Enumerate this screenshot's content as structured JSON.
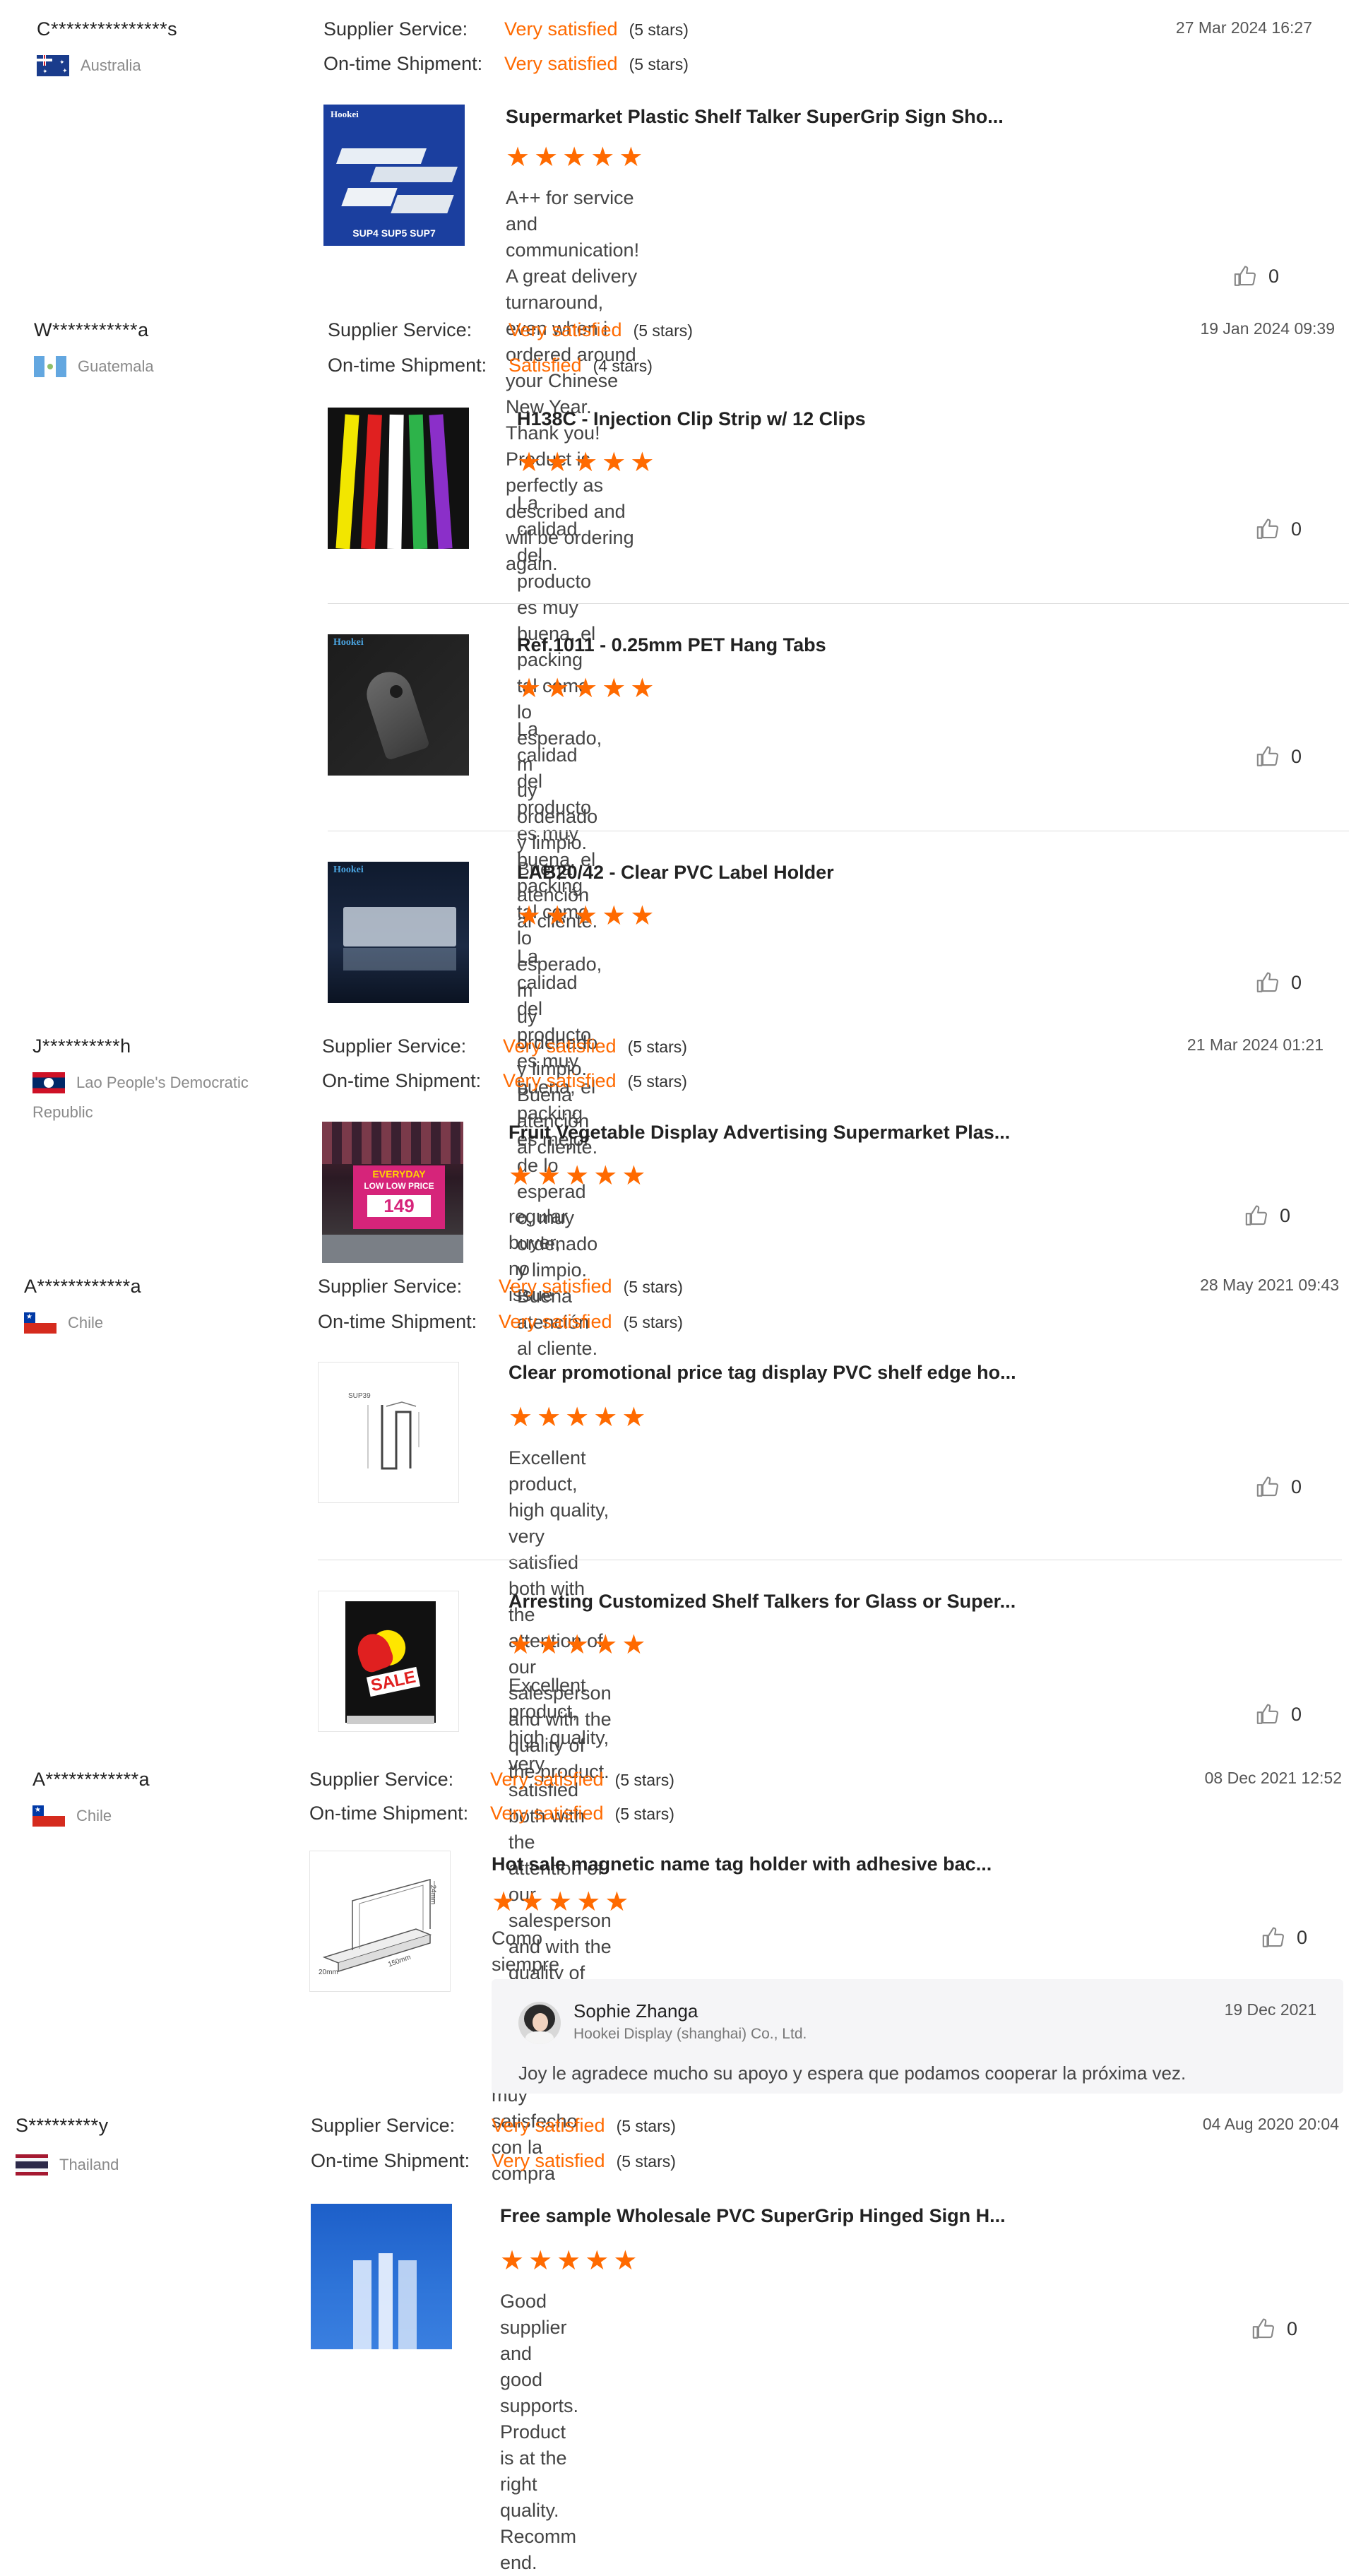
{
  "labels": {
    "supplier_service": "Supplier Service:",
    "ontime_shipment": "On-time Shipment:"
  },
  "colors": {
    "accent": "#ff6a00",
    "divider": "#dddddd",
    "reply_bg": "#f5f5f7"
  },
  "icons": {
    "like": "thumbs-up-icon",
    "star": "star-icon"
  },
  "reviews": [
    {
      "user": "C***************s",
      "country": "Australia",
      "date": "27 Mar 2024 16:27",
      "supplier_value": "Very satisfied",
      "supplier_stars": "(5 stars)",
      "shipment_value": "Very satisfied",
      "shipment_stars": "(5 stars)",
      "products": [
        {
          "title": "Supermarket Plastic Shelf Talker SuperGrip Sign Sho...",
          "rating": 5,
          "comment_lines": [
            "A++ for service and communication!",
            "A great delivery turnaround,",
            "even when i ordered around your Chinese New Year. Thank you!",
            "Product is perfectly as described and will be ordering again."
          ],
          "likes": "0",
          "thumb_text": "SUP4 SUP5 SUP7",
          "thumb_brand": "Hookei"
        }
      ]
    },
    {
      "user": "W***********a",
      "country": "Guatemala",
      "date": "19 Jan 2024 09:39",
      "supplier_value": "Very satisfied",
      "supplier_stars": "(5 stars)",
      "shipment_value": "Satisfied",
      "shipment_stars": "(4 stars)",
      "products": [
        {
          "title": "H138C - Injection Clip Strip w/ 12 Clips",
          "rating": 5,
          "comment_lines": [
            "La calidad del producto es muy buena, el packing tal como lo esperado, m",
            "uy ordenado y limpio. Buena atención al cliente."
          ],
          "likes": "0"
        },
        {
          "title": "Ref.1011 - 0.25mm PET Hang Tabs",
          "rating": 5,
          "comment_lines": [
            "La calidad del producto es muy buena, el packing tal como lo esperado, m",
            "uy ordenado y limpio. Buena atención al cliente."
          ],
          "likes": "0",
          "thumb_brand": "Hookei"
        },
        {
          "title": "LAB20/42 - Clear PVC Label Holder",
          "rating": 5,
          "comment_lines": [
            "La calidad del producto es muy buena, el packing es mejor de lo esperad",
            "o, muy ordenado y limpio. Buena atención al cliente."
          ],
          "likes": "0",
          "thumb_brand": "Hookei"
        }
      ]
    },
    {
      "user": "J**********h",
      "country_lines": [
        "Lao People's Democratic",
        "Republic"
      ],
      "date": "21 Mar 2024 01:21",
      "supplier_value": "Very satisfied",
      "supplier_stars": "(5 stars)",
      "shipment_value": "Very satisfied",
      "shipment_stars": "(5 stars)",
      "products": [
        {
          "title": "Fruit Vegetable Display Advertising Supermarket Plas...",
          "rating": 5,
          "comment_lines": [
            "regular buyer, no issue"
          ],
          "likes": "0",
          "thumb_text_1": "EVERYDAY",
          "thumb_text_2": "LOW LOW PRICE",
          "thumb_text_3": "149"
        }
      ]
    },
    {
      "user": "A************a",
      "country": "Chile",
      "date": "28 May 2021 09:43",
      "supplier_value": "Very satisfied",
      "supplier_stars": "(5 stars)",
      "shipment_value": "Very satisfied",
      "shipment_stars": "(5 stars)",
      "products": [
        {
          "title": "Clear promotional price tag display PVC shelf edge ho...",
          "rating": 5,
          "comment_lines": [
            "Excellent product, high quality, very satisfied both with the attention of our",
            "salesperson and with the quality of the product."
          ],
          "likes": "0",
          "thumb_text": "SUP39"
        },
        {
          "title": "Arresting Customized Shelf Talkers for Glass or Super...",
          "rating": 5,
          "comment_lines": [
            "Excellent product, high quality, very satisfied both with the attention of our",
            "salesperson and with the quality of the product."
          ],
          "likes": "0",
          "thumb_text": "SALE"
        }
      ]
    },
    {
      "user": "A************a",
      "country": "Chile",
      "date": "08 Dec 2021 12:52",
      "supplier_value": "Very satisfied",
      "supplier_stars": "(5 stars)",
      "shipment_value": "Very satisfied",
      "shipment_stars": "(5 stars)",
      "products": [
        {
          "title": "Hot sale magnetic name tag holder with adhesive bac...",
          "rating": 5,
          "comment_lines": [
            "Como siempre un producto de gran calidad, muy satisfecho con la compra"
          ],
          "likes": "0",
          "dim_1": "24mm",
          "dim_2": "150mm",
          "dim_3": "20mm"
        }
      ],
      "reply": {
        "name": "Sophie Zhanga",
        "company": "Hookei Display (shanghai) Co., Ltd.",
        "date": "19 Dec 2021",
        "text": "Joy le agradece mucho su apoyo y espera que podamos cooperar la próxima vez."
      }
    },
    {
      "user": "S*********y",
      "country": "Thailand",
      "date": "04 Aug 2020 20:04",
      "supplier_value": "Very satisfied",
      "supplier_stars": "(5 stars)",
      "shipment_value": "Very satisfied",
      "shipment_stars": "(5 stars)",
      "products": [
        {
          "title": "Free sample Wholesale PVC SuperGrip Hinged Sign H...",
          "rating": 5,
          "comment_lines": [
            "Good supplier and good supports. Product is at the right quality. Recomm",
            "end."
          ],
          "likes": "0"
        }
      ]
    }
  ]
}
